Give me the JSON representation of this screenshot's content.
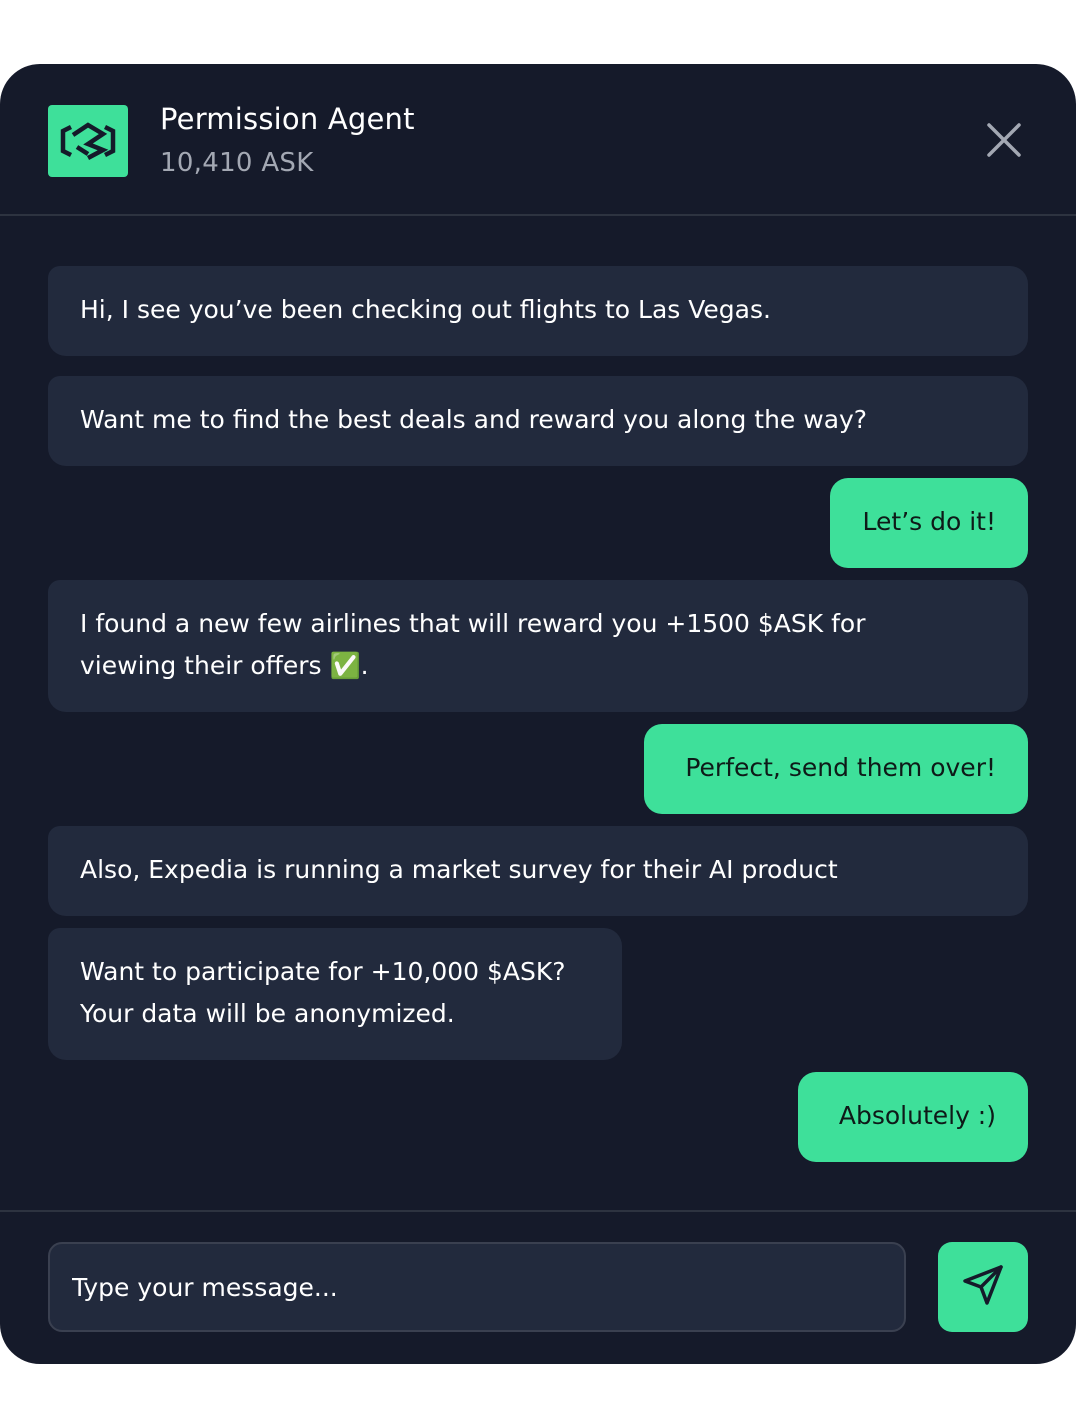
{
  "header": {
    "agent_name": "Permission Agent",
    "balance": "10,410 ASK",
    "logo_icon": "permission-logo-icon",
    "close_icon": "close-icon"
  },
  "messages": [
    {
      "sender": "agent",
      "text": "Hi, I see you’ve been checking out flights to Las Vegas."
    },
    {
      "sender": "agent",
      "text": "Want me to find the best deals and reward you along the way?"
    },
    {
      "sender": "user",
      "text": "Let’s do it!"
    },
    {
      "sender": "agent",
      "text": "I found a new few airlines that will reward you +1500 $ASK for\nviewing their offers ✅."
    },
    {
      "sender": "user",
      "text": "Perfect, send them over!"
    },
    {
      "sender": "agent",
      "text": "Also, Expedia is running a market survey for their AI product"
    },
    {
      "sender": "agent",
      "text": "Want to participate for +10,000 $ASK?\nYour data will be anonymized."
    },
    {
      "sender": "user",
      "text": "Absolutely :)"
    }
  ],
  "composer": {
    "placeholder": "Type your message...",
    "value": "",
    "send_icon": "send-icon"
  },
  "colors": {
    "background": "#151a2a",
    "agent_bubble": "#222a3d",
    "accent": "#3ee09a",
    "divider": "#2d3340"
  }
}
